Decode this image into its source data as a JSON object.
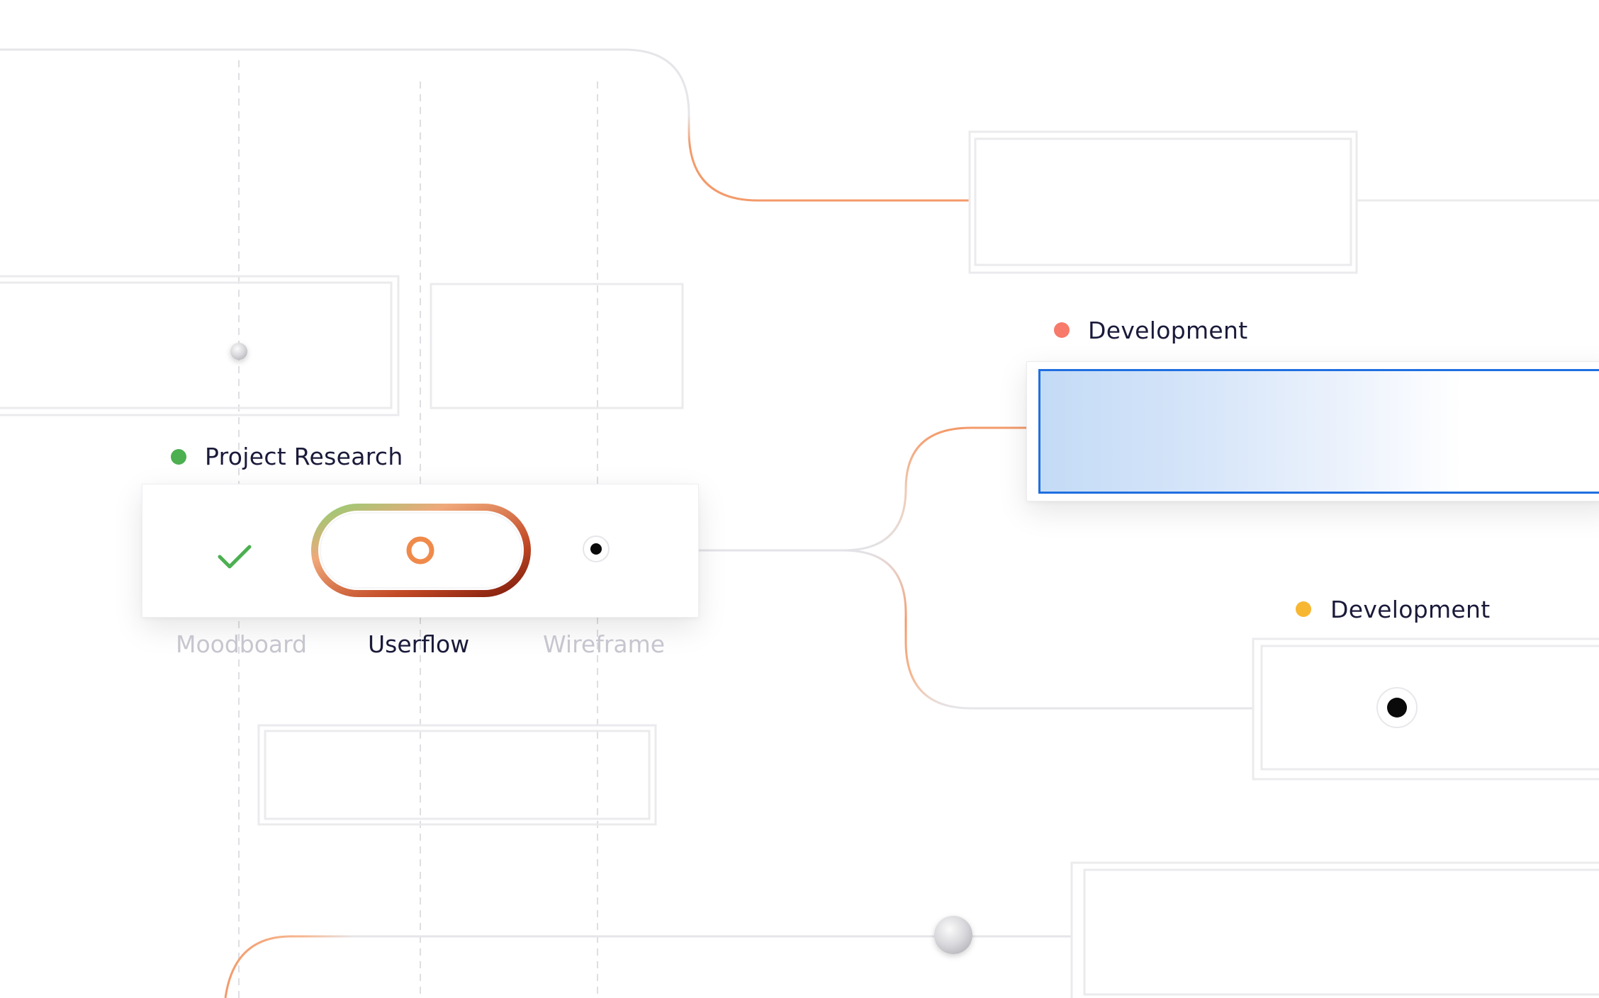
{
  "colors": {
    "accent_orange": "#f39a6a",
    "accent_blue": "#1f6fe0",
    "status_green": "#4caf50",
    "status_red": "#f77a6a",
    "status_yellow": "#f7b733",
    "connector_gray": "#e3e3e8"
  },
  "sections": {
    "project_research": {
      "label": "Project Research",
      "status_color": "#4caf50"
    },
    "development_primary": {
      "label": "Development",
      "status_color": "#f77a6a"
    },
    "development_secondary": {
      "label": "Development",
      "status_color": "#f7b733"
    }
  },
  "steps": [
    {
      "label": "Moodboard",
      "state": "done",
      "icon": "check-icon"
    },
    {
      "label": "Userflow",
      "state": "active",
      "icon": "progress-ring-icon"
    },
    {
      "label": "Wireframe",
      "state": "pending",
      "icon": "dot-icon"
    }
  ]
}
